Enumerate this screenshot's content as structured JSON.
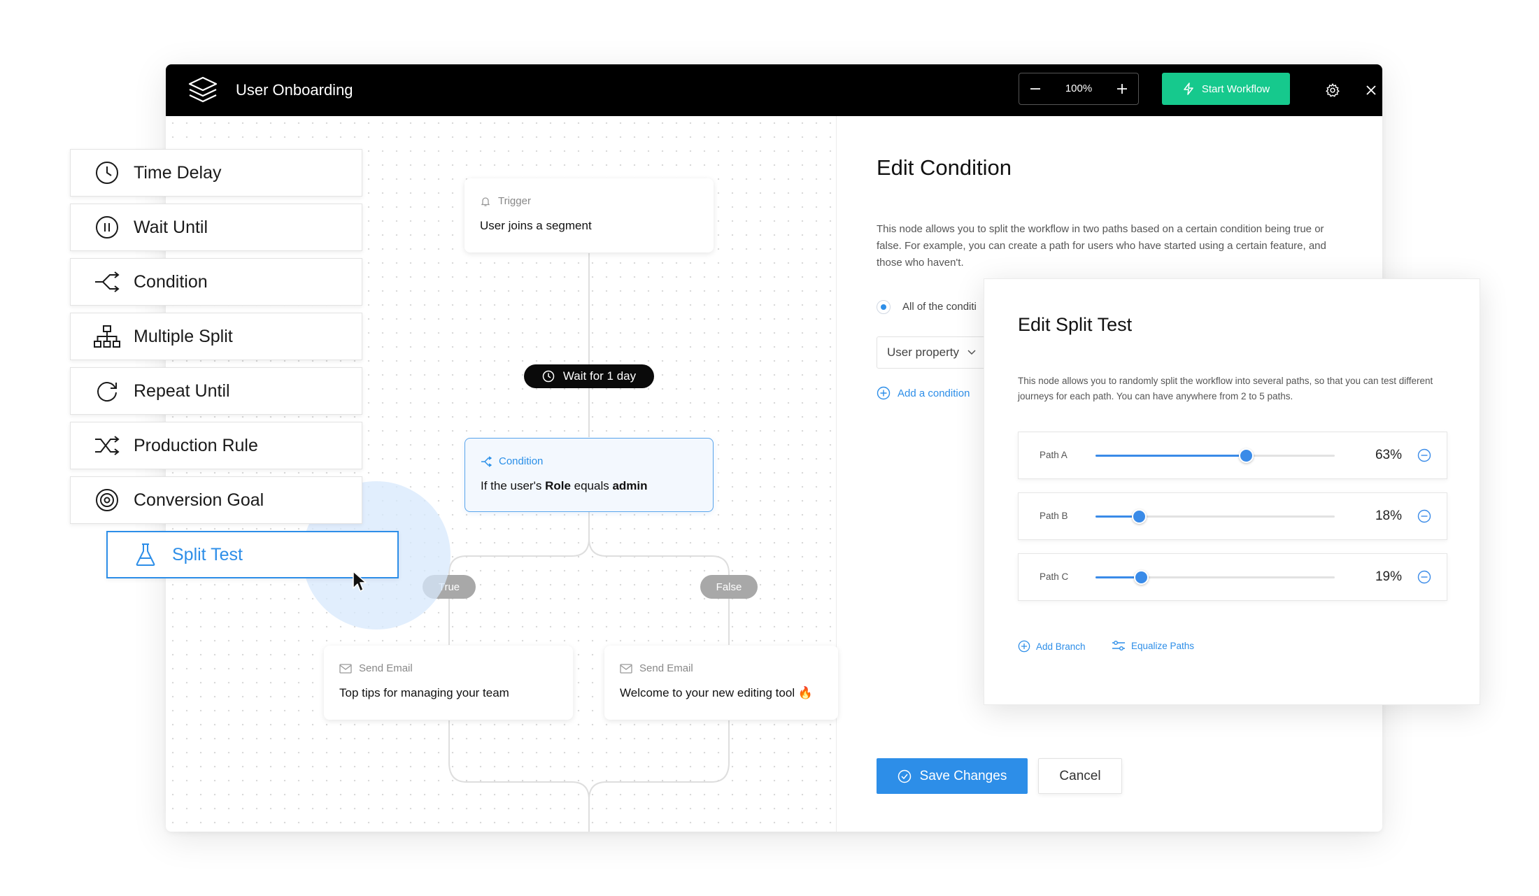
{
  "app": {
    "title": "User Onboarding",
    "zoom": "100%",
    "start_label": "Start Workflow",
    "accent": "#16c98d"
  },
  "palette": [
    {
      "label": "Time Delay",
      "icon": "clock-icon"
    },
    {
      "label": "Wait Until",
      "icon": "pause-circle-icon"
    },
    {
      "label": "Condition",
      "icon": "branch-icon"
    },
    {
      "label": "Multiple Split",
      "icon": "hierarchy-icon"
    },
    {
      "label": "Repeat Until",
      "icon": "repeat-icon"
    },
    {
      "label": "Production Rule",
      "icon": "shuffle-icon"
    },
    {
      "label": "Conversion Goal",
      "icon": "target-icon"
    }
  ],
  "dragging": {
    "label": "Split Test",
    "icon": "flask-icon",
    "color": "#2d8ee8"
  },
  "flow": {
    "trigger": {
      "type": "Trigger",
      "text": "User joins a segment"
    },
    "wait": {
      "text": "Wait for 1 day"
    },
    "condition": {
      "type": "Condition",
      "text_prefix": "If the user's ",
      "role": "Role",
      "text_mid": " equals ",
      "value": "admin"
    },
    "true_label": "True",
    "false_label": "False",
    "email_left": {
      "type": "Send Email",
      "text": "Top tips for managing your team"
    },
    "email_right": {
      "type": "Send Email",
      "text": "Welcome to your new editing tool 🔥"
    }
  },
  "edit_condition": {
    "title": "Edit Condition",
    "description": "This node allows you to split the workflow in two paths based on a certain condition being true or false. For example, you can create a path for users who have started using a certain feature, and those who haven't.",
    "radio_label": "All of the conditi",
    "select_value": "User property",
    "add_condition": "Add a condition",
    "save_label": "Save Changes",
    "cancel_label": "Cancel"
  },
  "split_test": {
    "title": "Edit Split Test",
    "description": "This node allows you to randomly split the workflow into several paths, so that you can test different journeys for each path. You can have anywhere from 2 to 5 paths.",
    "paths": [
      {
        "label": "Path A",
        "percent": 63,
        "percent_label": "63%"
      },
      {
        "label": "Path B",
        "percent": 18,
        "percent_label": "18%"
      },
      {
        "label": "Path C",
        "percent": 19,
        "percent_label": "19%"
      }
    ],
    "add_branch": "Add Branch",
    "equalize": "Equalize Paths"
  }
}
